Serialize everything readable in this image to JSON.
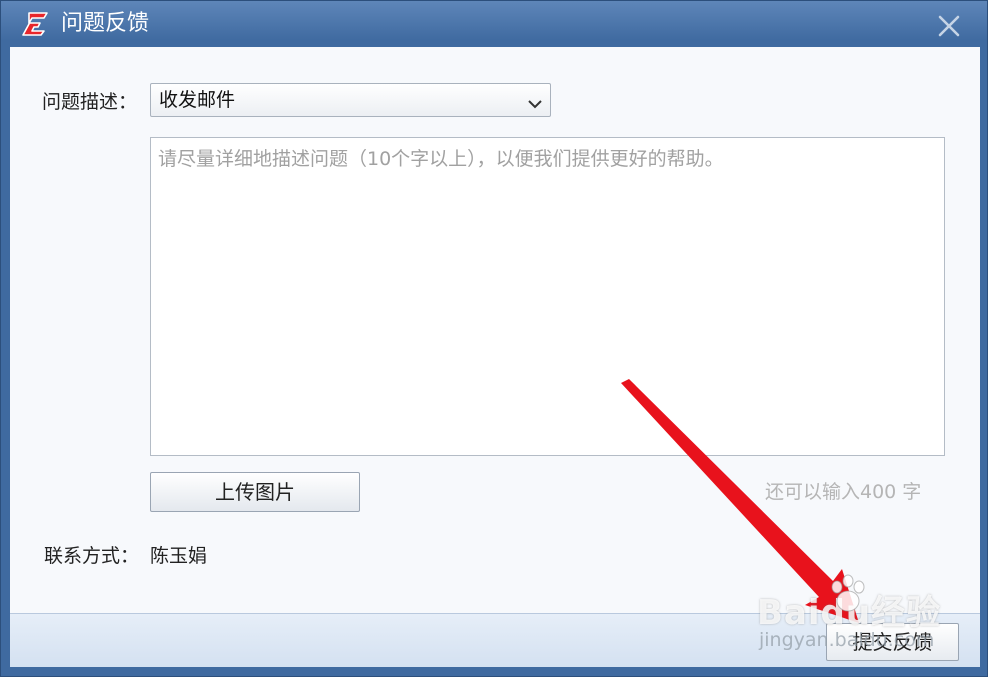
{
  "window": {
    "title": "问题反馈",
    "accent": "#3f6aa0"
  },
  "icons": {
    "app": "app-logo-icon",
    "close": "close-icon",
    "dropdown": "chevron-down-icon"
  },
  "form": {
    "category_label": "问题描述：",
    "category_value": "收发邮件",
    "description_placeholder": "请尽量详细地描述问题（10个字以上），以便我们提供更好的帮助。",
    "upload_button": "上传图片",
    "char_counter": "还可以输入400 字",
    "contact_label": "联系方式：",
    "contact_value": "陈玉娟",
    "submit_button": "提交反馈"
  },
  "watermark": {
    "brand": "Baidu经验",
    "url": "jingyan.baidu.com"
  },
  "annotation": {
    "arrow_color": "#e8121c"
  }
}
